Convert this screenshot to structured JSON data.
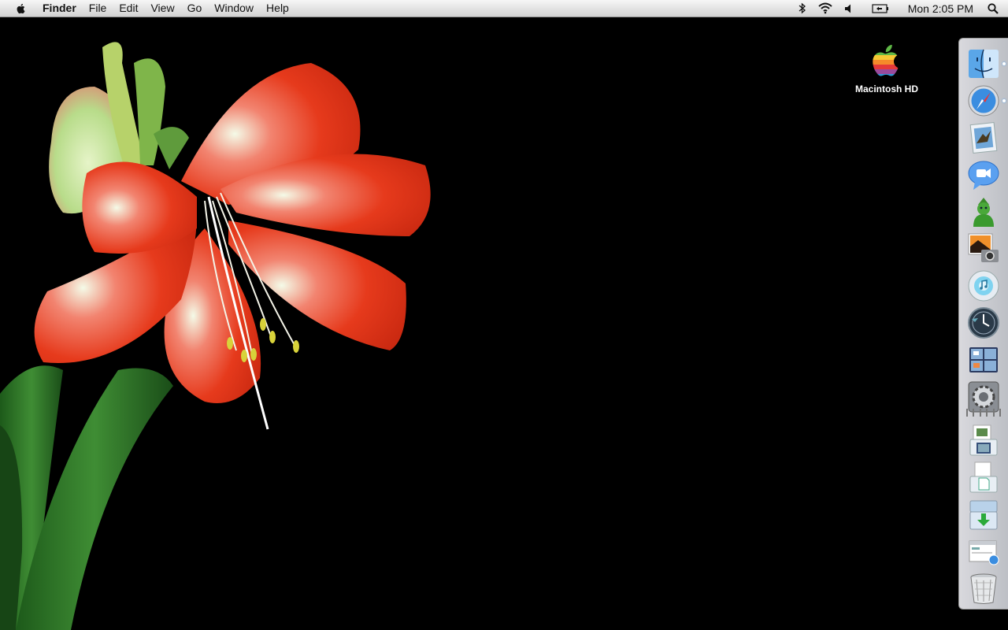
{
  "menubar": {
    "apple_icon": "apple-icon",
    "app_name": "Finder",
    "menus": [
      "File",
      "Edit",
      "View",
      "Go",
      "Window",
      "Help"
    ],
    "status_icons": [
      "bluetooth-icon",
      "wifi-icon",
      "volume-icon",
      "battery-icon"
    ],
    "clock": "Mon 2:05 PM",
    "spotlight_icon": "spotlight-search-icon"
  },
  "desktop": {
    "wallpaper": "red amaryllis flower on black background",
    "icons": [
      {
        "label": "Macintosh HD",
        "icon": "hard-drive-icon"
      }
    ]
  },
  "dock": {
    "position": "right",
    "apps": [
      {
        "name": "finder-icon",
        "running": true
      },
      {
        "name": "safari-icon",
        "running": true
      },
      {
        "name": "mail-icon",
        "running": false
      },
      {
        "name": "ichat-icon",
        "running": false
      },
      {
        "name": "address-book-icon",
        "running": false
      },
      {
        "name": "iphoto-icon",
        "running": false
      },
      {
        "name": "itunes-icon",
        "running": false
      },
      {
        "name": "time-machine-icon",
        "running": false
      },
      {
        "name": "spaces-icon",
        "running": false
      },
      {
        "name": "system-preferences-icon",
        "running": false
      }
    ],
    "stacks": [
      {
        "name": "applications-stack-icon"
      },
      {
        "name": "documents-stack-icon"
      },
      {
        "name": "downloads-stack-icon"
      },
      {
        "name": "web-location-icon"
      },
      {
        "name": "trash-icon"
      }
    ]
  },
  "colors": {
    "menubar": "#e2e2e2",
    "desktop_background": "#000000",
    "flower_red": "#e63a1c",
    "leaf_green": "#2f7a2a"
  }
}
